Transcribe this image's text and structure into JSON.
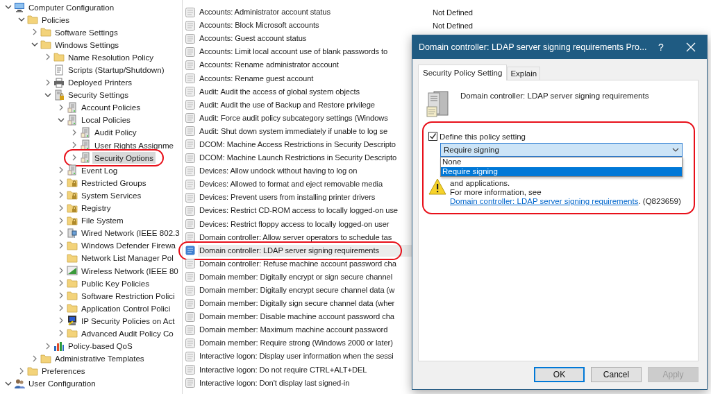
{
  "tree": {
    "items": [
      {
        "label": "Computer Configuration",
        "kind": "computer",
        "expanded": true,
        "selected": false,
        "children": [
          {
            "label": "Policies",
            "kind": "folder",
            "expanded": true,
            "selected": false,
            "children": [
              {
                "label": "Software Settings",
                "kind": "folder",
                "expanded": false,
                "selected": false
              },
              {
                "label": "Windows Settings",
                "kind": "folder",
                "expanded": true,
                "selected": false,
                "children": [
                  {
                    "label": "Name Resolution Policy",
                    "kind": "folder",
                    "expanded": false,
                    "selected": false
                  },
                  {
                    "label": "Scripts (Startup/Shutdown)",
                    "kind": "script",
                    "selected": false
                  },
                  {
                    "label": "Deployed Printers",
                    "kind": "printer",
                    "expanded": false,
                    "selected": false
                  },
                  {
                    "label": "Security Settings",
                    "kind": "security",
                    "expanded": true,
                    "selected": false,
                    "children": [
                      {
                        "label": "Account Policies",
                        "kind": "policy",
                        "expanded": false,
                        "selected": false
                      },
                      {
                        "label": "Local Policies",
                        "kind": "policy",
                        "expanded": true,
                        "selected": false,
                        "children": [
                          {
                            "label": "Audit Policy",
                            "kind": "policy",
                            "expanded": false,
                            "selected": false
                          },
                          {
                            "label": "User Rights Assignme",
                            "kind": "policy",
                            "expanded": false,
                            "selected": false
                          },
                          {
                            "label": "Security Options",
                            "kind": "policy",
                            "expanded": false,
                            "selected": true,
                            "circled": true
                          }
                        ]
                      },
                      {
                        "label": "Event Log",
                        "kind": "policy",
                        "expanded": false,
                        "selected": false
                      },
                      {
                        "label": "Restricted Groups",
                        "kind": "lockfolder",
                        "expanded": false,
                        "selected": false
                      },
                      {
                        "label": "System Services",
                        "kind": "lockfolder",
                        "expanded": false,
                        "selected": false
                      },
                      {
                        "label": "Registry",
                        "kind": "lockfolder",
                        "expanded": false,
                        "selected": false
                      },
                      {
                        "label": "File System",
                        "kind": "lockfolder",
                        "expanded": false,
                        "selected": false
                      },
                      {
                        "label": "Wired Network (IEEE 802.3",
                        "kind": "wired",
                        "expanded": false,
                        "selected": false
                      },
                      {
                        "label": "Windows Defender Firewa",
                        "kind": "folder",
                        "expanded": false,
                        "selected": false
                      },
                      {
                        "label": "Network List Manager Pol",
                        "kind": "folder",
                        "selected": false
                      },
                      {
                        "label": "Wireless Network (IEEE 80",
                        "kind": "wireless",
                        "expanded": false,
                        "selected": false
                      },
                      {
                        "label": "Public Key Policies",
                        "kind": "folder",
                        "expanded": false,
                        "selected": false
                      },
                      {
                        "label": "Software Restriction Polici",
                        "kind": "folder",
                        "expanded": false,
                        "selected": false
                      },
                      {
                        "label": "Application Control Polici",
                        "kind": "folder",
                        "expanded": false,
                        "selected": false
                      },
                      {
                        "label": "IP Security Policies on Act",
                        "kind": "ipsec",
                        "expanded": false,
                        "selected": false
                      },
                      {
                        "label": "Advanced Audit Policy Co",
                        "kind": "folder",
                        "expanded": false,
                        "selected": false
                      }
                    ]
                  },
                  {
                    "label": "Policy-based QoS",
                    "kind": "qos",
                    "expanded": false,
                    "selected": false
                  }
                ]
              },
              {
                "label": "Administrative Templates",
                "kind": "folder",
                "expanded": false,
                "selected": false
              }
            ]
          },
          {
            "label": "Preferences",
            "kind": "folder",
            "expanded": false,
            "selected": false
          }
        ]
      },
      {
        "label": "User Configuration",
        "kind": "user",
        "expanded": true,
        "selected": false
      }
    ]
  },
  "policy_list": {
    "rows": [
      {
        "policy": "Accounts: Administrator account status",
        "column_2": "Not Defined",
        "selected": false
      },
      {
        "policy": "Accounts: Block Microsoft accounts",
        "column_2": "Not Defined",
        "selected": false
      },
      {
        "policy": "Accounts: Guest account status",
        "selected": false
      },
      {
        "policy": "Accounts: Limit local account use of blank passwords to",
        "selected": false
      },
      {
        "policy": "Accounts: Rename administrator account",
        "selected": false
      },
      {
        "policy": "Accounts: Rename guest account",
        "selected": false
      },
      {
        "policy": "Audit: Audit the access of global system objects",
        "selected": false
      },
      {
        "policy": "Audit: Audit the use of Backup and Restore privilege",
        "selected": false
      },
      {
        "policy": "Audit: Force audit policy subcategory settings (Windows",
        "selected": false
      },
      {
        "policy": "Audit: Shut down system immediately if unable to log se",
        "selected": false
      },
      {
        "policy": "DCOM: Machine Access Restrictions in Security Descripto",
        "selected": false
      },
      {
        "policy": "DCOM: Machine Launch Restrictions in Security Descripto",
        "selected": false
      },
      {
        "policy": "Devices: Allow undock without having to log on",
        "selected": false
      },
      {
        "policy": "Devices: Allowed to format and eject removable media",
        "selected": false
      },
      {
        "policy": "Devices: Prevent users from installing printer drivers",
        "selected": false
      },
      {
        "policy": "Devices: Restrict CD-ROM access to locally logged-on use",
        "selected": false
      },
      {
        "policy": "Devices: Restrict floppy access to locally logged-on user",
        "selected": false
      },
      {
        "policy": "Domain controller: Allow server operators to schedule tas",
        "selected": false
      },
      {
        "policy": "Domain controller: LDAP server signing requirements",
        "selected": true,
        "circled": true
      },
      {
        "policy": "Domain controller: Refuse machine account password cha",
        "selected": false
      },
      {
        "policy": "Domain member: Digitally encrypt or sign secure channel",
        "selected": false
      },
      {
        "policy": "Domain member: Digitally encrypt secure channel data (w",
        "selected": false
      },
      {
        "policy": "Domain member: Digitally sign secure channel data (wher",
        "selected": false
      },
      {
        "policy": "Domain member: Disable machine account password cha",
        "selected": false
      },
      {
        "policy": "Domain member: Maximum machine account password",
        "selected": false
      },
      {
        "policy": "Domain member: Require strong (Windows 2000 or later)",
        "selected": false
      },
      {
        "policy": "Interactive logon: Display user information when the sessi",
        "selected": false
      },
      {
        "policy": "Interactive logon: Do not require CTRL+ALT+DEL",
        "selected": false
      },
      {
        "policy": "Interactive logon: Don't display last signed-in",
        "selected": false
      }
    ]
  },
  "dialog": {
    "title": "Domain controller: LDAP server signing requirements Pro...",
    "help_button": "?",
    "tabs": [
      {
        "label": "Security Policy Setting",
        "selected": true
      },
      {
        "label": "Explain",
        "selected": false
      }
    ],
    "policy_name": "Domain controller: LDAP server signing requirements",
    "setting_group": {
      "circled": true,
      "checkbox": {
        "label": "Define this policy setting",
        "checked": true
      },
      "dropdown": {
        "value": "Require signing",
        "expanded": true,
        "options": [
          {
            "label": "None",
            "selected": false
          },
          {
            "label": "Require signing",
            "selected": true
          }
        ]
      },
      "warning_text": "and applications.",
      "more_info": "For more information, see",
      "link": "Domain controller: LDAP server signing requirements",
      "after_link": ". (Q823659)"
    },
    "buttons": [
      {
        "label": "OK",
        "kind": "default",
        "disabled": false
      },
      {
        "label": "Cancel",
        "kind": "normal",
        "disabled": false
      },
      {
        "label": "Apply",
        "kind": "normal",
        "disabled": true
      }
    ]
  }
}
